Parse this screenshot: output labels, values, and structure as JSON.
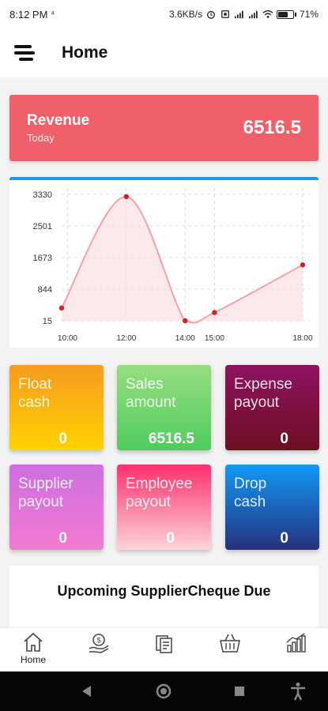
{
  "status_bar": {
    "time": "8:12 PM",
    "net_arrow": "⁴",
    "speed": "3.6KB/s",
    "battery": "71"
  },
  "header": {
    "title": "Home",
    "menu_icon": "hamburger-menu-icon"
  },
  "revenue": {
    "label": "Revenue",
    "period": "Today",
    "value": "6516.5",
    "color": "#f0606a"
  },
  "chart_data": {
    "type": "area",
    "x": [
      "10:00",
      "12:00",
      "14:00",
      "15:00",
      "18:00"
    ],
    "points": [
      {
        "x": 9.8,
        "y": 350
      },
      {
        "x": 12.0,
        "y": 3270
      },
      {
        "x": 14.0,
        "y": 15
      },
      {
        "x": 15.0,
        "y": 230
      },
      {
        "x": 18.0,
        "y": 1480
      }
    ],
    "y_ticks": [
      "3330",
      "2501",
      "1673",
      "844",
      "15"
    ],
    "x_ticks": [
      "10:00",
      "12:00",
      "14:00",
      "15:00",
      "18:00"
    ],
    "ylim": [
      15,
      3330
    ],
    "grid": true,
    "line_color": "#f4a1a8",
    "point_color": "#d61f1f"
  },
  "tiles": [
    {
      "label": "Float cash",
      "value": "0"
    },
    {
      "label": "Sales amount",
      "value": "6516.5"
    },
    {
      "label": "Expense payout",
      "value": "0"
    },
    {
      "label": "Supplier payout",
      "value": "0"
    },
    {
      "label": "Employee payout",
      "value": "0"
    },
    {
      "label": "Drop cash",
      "value": "0"
    }
  ],
  "upcoming": {
    "title": "Upcoming SupplierCheque Due"
  },
  "bottom_nav": {
    "home_label": "Home",
    "items": [
      "home-icon",
      "money-hand-icon",
      "receipt-icon",
      "basket-icon",
      "bar-chart-icon"
    ]
  }
}
